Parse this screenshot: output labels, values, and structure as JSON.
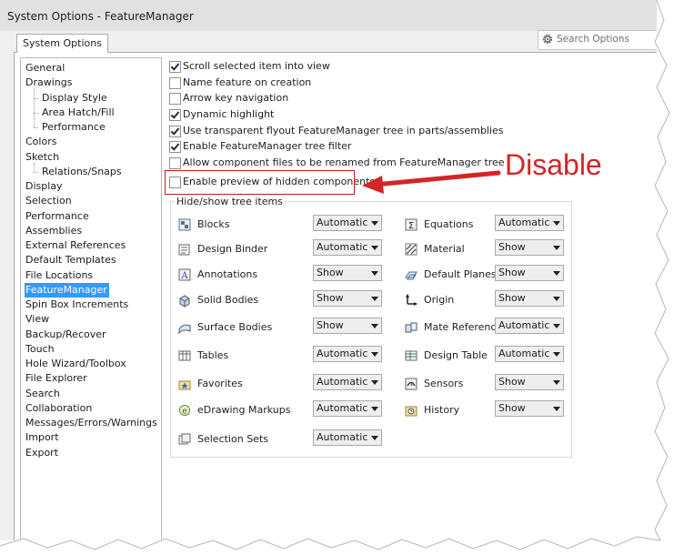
{
  "window": {
    "title": "System Options - FeatureManager",
    "tab_label": "System Options"
  },
  "search": {
    "placeholder": "Search Options",
    "icon": "gear-icon"
  },
  "nav": {
    "items": [
      {
        "label": "General",
        "indent": 0
      },
      {
        "label": "Drawings",
        "indent": 0
      },
      {
        "label": "Display Style",
        "indent": 1
      },
      {
        "label": "Area Hatch/Fill",
        "indent": 1
      },
      {
        "label": "Performance",
        "indent": 1
      },
      {
        "label": "Colors",
        "indent": 0
      },
      {
        "label": "Sketch",
        "indent": 0
      },
      {
        "label": "Relations/Snaps",
        "indent": 1
      },
      {
        "label": "Display",
        "indent": 0
      },
      {
        "label": "Selection",
        "indent": 0
      },
      {
        "label": "Performance",
        "indent": 0
      },
      {
        "label": "Assemblies",
        "indent": 0
      },
      {
        "label": "External References",
        "indent": 0
      },
      {
        "label": "Default Templates",
        "indent": 0
      },
      {
        "label": "File Locations",
        "indent": 0
      },
      {
        "label": "FeatureManager",
        "indent": 0,
        "active": true
      },
      {
        "label": "Spin Box Increments",
        "indent": 0
      },
      {
        "label": "View",
        "indent": 0
      },
      {
        "label": "Backup/Recover",
        "indent": 0
      },
      {
        "label": "Touch",
        "indent": 0
      },
      {
        "label": "Hole Wizard/Toolbox",
        "indent": 0
      },
      {
        "label": "File Explorer",
        "indent": 0
      },
      {
        "label": "Search",
        "indent": 0
      },
      {
        "label": "Collaboration",
        "indent": 0
      },
      {
        "label": "Messages/Errors/Warnings",
        "indent": 0
      },
      {
        "label": "Import",
        "indent": 0
      },
      {
        "label": "Export",
        "indent": 0
      }
    ]
  },
  "options": [
    {
      "label": "Scroll selected item into view",
      "checked": true
    },
    {
      "label": "Name feature on creation",
      "checked": false
    },
    {
      "label": "Arrow key navigation",
      "checked": false
    },
    {
      "label": "Dynamic highlight",
      "checked": true
    },
    {
      "label": "Use transparent flyout FeatureManager tree in parts/assemblies",
      "checked": true
    },
    {
      "label": "Enable FeatureManager tree filter",
      "checked": true
    },
    {
      "label": "Allow component files to be renamed from FeatureManager tree",
      "checked": false
    },
    {
      "label": "Enable preview of hidden components",
      "checked": false
    }
  ],
  "tree_items": {
    "title": "Hide/show tree items",
    "left": [
      {
        "label": "Blocks",
        "value": "Automatic",
        "icon": "blocks-icon"
      },
      {
        "label": "Design Binder",
        "value": "Automatic",
        "icon": "design-binder-icon"
      },
      {
        "label": "Annotations",
        "value": "Show",
        "icon": "annotations-icon"
      },
      {
        "label": "Solid Bodies",
        "value": "Show",
        "icon": "solid-bodies-icon"
      },
      {
        "label": "Surface Bodies",
        "value": "Show",
        "icon": "surface-bodies-icon"
      },
      {
        "label": "Tables",
        "value": "Automatic",
        "icon": "tables-icon"
      },
      {
        "label": "Favorites",
        "value": "Automatic",
        "icon": "favorites-icon"
      },
      {
        "label": "eDrawing Markups",
        "value": "Automatic",
        "icon": "edrawing-markups-icon"
      },
      {
        "label": "Selection Sets",
        "value": "Automatic",
        "icon": "selection-sets-icon"
      }
    ],
    "right": [
      {
        "label": "Equations",
        "value": "Automatic",
        "icon": "equations-icon"
      },
      {
        "label": "Material",
        "value": "Show",
        "icon": "material-icon"
      },
      {
        "label": "Default Planes",
        "value": "Show",
        "icon": "default-planes-icon"
      },
      {
        "label": "Origin",
        "value": "Show",
        "icon": "origin-icon"
      },
      {
        "label": "Mate References",
        "value": "Automatic",
        "icon": "mate-references-icon"
      },
      {
        "label": "Design Table",
        "value": "Automatic",
        "icon": "design-table-icon"
      },
      {
        "label": "Sensors",
        "value": "Show",
        "icon": "sensors-icon"
      },
      {
        "label": "History",
        "value": "Show",
        "icon": "history-icon"
      }
    ]
  },
  "annotation": {
    "callout_text": "Disable",
    "color": "#d42525"
  },
  "colors": {
    "selection": "#3399ff",
    "callout_red": "#d42525"
  }
}
